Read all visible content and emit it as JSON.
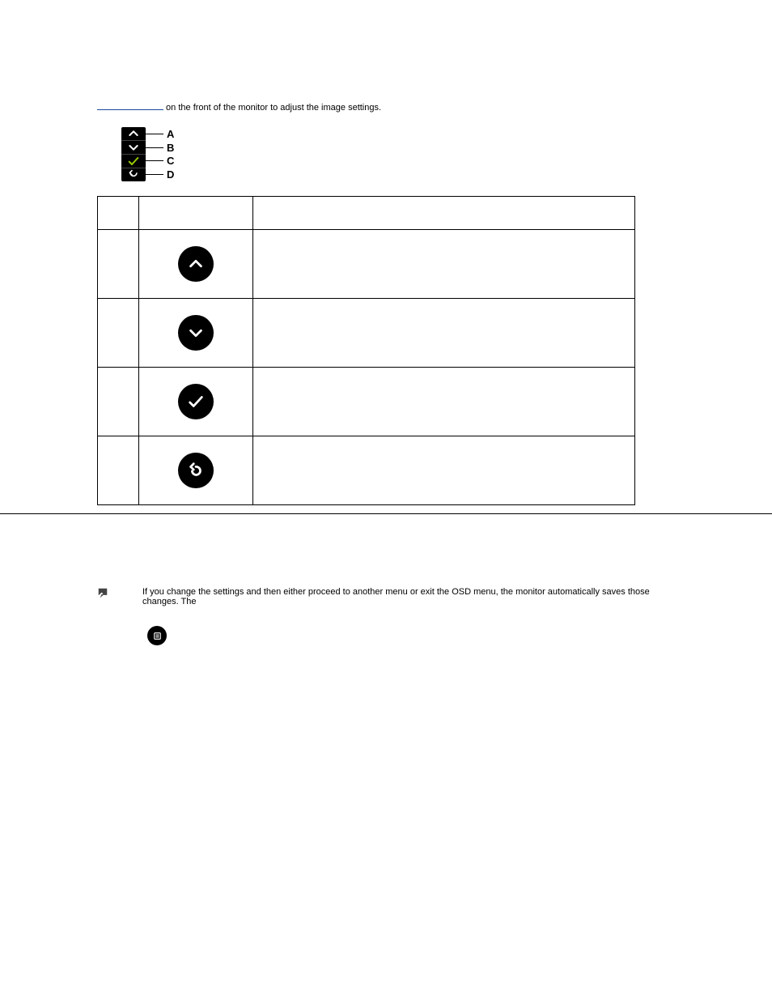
{
  "lead": {
    "line1_after": " on the front of the monitor to adjust the image settings."
  },
  "panel": {
    "labels": [
      "A",
      "B",
      "C",
      "D"
    ]
  },
  "table": {
    "headers": {
      "col1": "",
      "col2": "",
      "col3": ""
    },
    "rows": [
      {
        "letter": "",
        "icon": "up-icon",
        "desc": ""
      },
      {
        "letter": "",
        "icon": "down-icon",
        "desc": ""
      },
      {
        "letter": "",
        "icon": "check-icon",
        "desc": ""
      },
      {
        "letter": "",
        "icon": "back-icon",
        "desc": ""
      }
    ]
  },
  "note": {
    "text": "If you change the settings and then either proceed to another menu or exit the OSD menu, the monitor automatically saves those changes. The"
  },
  "menu_step": {
    "text": ""
  }
}
